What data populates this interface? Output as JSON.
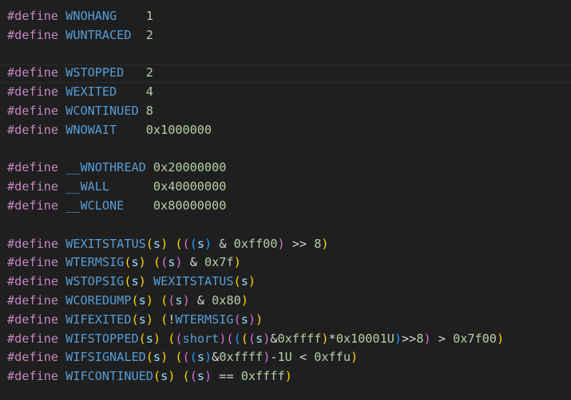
{
  "editor": {
    "language": "c",
    "current_line_index": 3,
    "theme_colors": {
      "background": "#1f1f1f",
      "directive": "#c586c0",
      "macro": "#569cd6",
      "number": "#b5cea8",
      "operator": "#d4d4d4",
      "param": "#9cdcfe",
      "bracket_gold": "#ffd700",
      "bracket_pink": "#da70d6",
      "bracket_blue": "#179fff"
    },
    "lines": [
      {
        "text": "#define WNOHANG    1",
        "tokens": [
          {
            "t": "#define",
            "c": "directive"
          },
          {
            "t": " "
          },
          {
            "t": "WNOHANG",
            "c": "macro"
          },
          {
            "t": "    "
          },
          {
            "t": "1",
            "c": "number"
          }
        ]
      },
      {
        "text": "#define WUNTRACED  2",
        "tokens": [
          {
            "t": "#define",
            "c": "directive"
          },
          {
            "t": " "
          },
          {
            "t": "WUNTRACED",
            "c": "macro"
          },
          {
            "t": "  "
          },
          {
            "t": "2",
            "c": "number"
          }
        ]
      },
      {
        "text": "",
        "tokens": []
      },
      {
        "text": "#define WSTOPPED   2",
        "tokens": [
          {
            "t": "#define",
            "c": "directive"
          },
          {
            "t": " "
          },
          {
            "t": "WSTOPPED",
            "c": "macro"
          },
          {
            "t": "   "
          },
          {
            "t": "2",
            "c": "number"
          }
        ]
      },
      {
        "text": "#define WEXITED    4",
        "tokens": [
          {
            "t": "#define",
            "c": "directive"
          },
          {
            "t": " "
          },
          {
            "t": "WEXITED",
            "c": "macro"
          },
          {
            "t": "    "
          },
          {
            "t": "4",
            "c": "number"
          }
        ]
      },
      {
        "text": "#define WCONTINUED 8",
        "tokens": [
          {
            "t": "#define",
            "c": "directive"
          },
          {
            "t": " "
          },
          {
            "t": "WCONTINUED",
            "c": "macro"
          },
          {
            "t": " "
          },
          {
            "t": "8",
            "c": "number"
          }
        ]
      },
      {
        "text": "#define WNOWAIT    0x1000000",
        "tokens": [
          {
            "t": "#define",
            "c": "directive"
          },
          {
            "t": " "
          },
          {
            "t": "WNOWAIT",
            "c": "macro"
          },
          {
            "t": "    "
          },
          {
            "t": "0x1000000",
            "c": "number"
          }
        ]
      },
      {
        "text": "",
        "tokens": []
      },
      {
        "text": "#define __WNOTHREAD 0x20000000",
        "tokens": [
          {
            "t": "#define",
            "c": "directive"
          },
          {
            "t": " "
          },
          {
            "t": "__WNOTHREAD",
            "c": "macro"
          },
          {
            "t": " "
          },
          {
            "t": "0x20000000",
            "c": "number"
          }
        ]
      },
      {
        "text": "#define __WALL      0x40000000",
        "tokens": [
          {
            "t": "#define",
            "c": "directive"
          },
          {
            "t": " "
          },
          {
            "t": "__WALL",
            "c": "macro"
          },
          {
            "t": "      "
          },
          {
            "t": "0x40000000",
            "c": "number"
          }
        ]
      },
      {
        "text": "#define __WCLONE    0x80000000",
        "tokens": [
          {
            "t": "#define",
            "c": "directive"
          },
          {
            "t": " "
          },
          {
            "t": "__WCLONE",
            "c": "macro"
          },
          {
            "t": "    "
          },
          {
            "t": "0x80000000",
            "c": "number"
          }
        ]
      },
      {
        "text": "",
        "tokens": []
      },
      {
        "text": "#define WEXITSTATUS(s) (((s) & 0xff00) >> 8)",
        "tokens": [
          {
            "t": "#define",
            "c": "directive"
          },
          {
            "t": " "
          },
          {
            "t": "WEXITSTATUS",
            "c": "macro"
          },
          {
            "t": "(",
            "c": "bracket_gold"
          },
          {
            "t": "s",
            "c": "param"
          },
          {
            "t": ")",
            "c": "bracket_gold"
          },
          {
            "t": " "
          },
          {
            "t": "(",
            "c": "bracket_gold"
          },
          {
            "t": "(",
            "c": "bracket_pink"
          },
          {
            "t": "(",
            "c": "bracket_blue"
          },
          {
            "t": "s",
            "c": "param"
          },
          {
            "t": ")",
            "c": "bracket_blue"
          },
          {
            "t": " & ",
            "c": "operator"
          },
          {
            "t": "0xff00",
            "c": "number"
          },
          {
            "t": ")",
            "c": "bracket_pink"
          },
          {
            "t": " >> ",
            "c": "operator"
          },
          {
            "t": "8",
            "c": "number"
          },
          {
            "t": ")",
            "c": "bracket_gold"
          }
        ]
      },
      {
        "text": "#define WTERMSIG(s) ((s) & 0x7f)",
        "tokens": [
          {
            "t": "#define",
            "c": "directive"
          },
          {
            "t": " "
          },
          {
            "t": "WTERMSIG",
            "c": "macro"
          },
          {
            "t": "(",
            "c": "bracket_gold"
          },
          {
            "t": "s",
            "c": "param"
          },
          {
            "t": ")",
            "c": "bracket_gold"
          },
          {
            "t": " "
          },
          {
            "t": "(",
            "c": "bracket_gold"
          },
          {
            "t": "(",
            "c": "bracket_pink"
          },
          {
            "t": "s",
            "c": "param"
          },
          {
            "t": ")",
            "c": "bracket_pink"
          },
          {
            "t": " & ",
            "c": "operator"
          },
          {
            "t": "0x7f",
            "c": "number"
          },
          {
            "t": ")",
            "c": "bracket_gold"
          }
        ]
      },
      {
        "text": "#define WSTOPSIG(s) WEXITSTATUS(s)",
        "tokens": [
          {
            "t": "#define",
            "c": "directive"
          },
          {
            "t": " "
          },
          {
            "t": "WSTOPSIG",
            "c": "macro"
          },
          {
            "t": "(",
            "c": "bracket_gold"
          },
          {
            "t": "s",
            "c": "param"
          },
          {
            "t": ")",
            "c": "bracket_gold"
          },
          {
            "t": " "
          },
          {
            "t": "WEXITSTATUS",
            "c": "macro"
          },
          {
            "t": "(",
            "c": "bracket_gold"
          },
          {
            "t": "s",
            "c": "param"
          },
          {
            "t": ")",
            "c": "bracket_gold"
          }
        ]
      },
      {
        "text": "#define WCOREDUMP(s) ((s) & 0x80)",
        "tokens": [
          {
            "t": "#define",
            "c": "directive"
          },
          {
            "t": " "
          },
          {
            "t": "WCOREDUMP",
            "c": "macro"
          },
          {
            "t": "(",
            "c": "bracket_gold"
          },
          {
            "t": "s",
            "c": "param"
          },
          {
            "t": ")",
            "c": "bracket_gold"
          },
          {
            "t": " "
          },
          {
            "t": "(",
            "c": "bracket_gold"
          },
          {
            "t": "(",
            "c": "bracket_pink"
          },
          {
            "t": "s",
            "c": "param"
          },
          {
            "t": ")",
            "c": "bracket_pink"
          },
          {
            "t": " & ",
            "c": "operator"
          },
          {
            "t": "0x80",
            "c": "number"
          },
          {
            "t": ")",
            "c": "bracket_gold"
          }
        ]
      },
      {
        "text": "#define WIFEXITED(s) (!WTERMSIG(s))",
        "tokens": [
          {
            "t": "#define",
            "c": "directive"
          },
          {
            "t": " "
          },
          {
            "t": "WIFEXITED",
            "c": "macro"
          },
          {
            "t": "(",
            "c": "bracket_gold"
          },
          {
            "t": "s",
            "c": "param"
          },
          {
            "t": ")",
            "c": "bracket_gold"
          },
          {
            "t": " "
          },
          {
            "t": "(",
            "c": "bracket_gold"
          },
          {
            "t": "!",
            "c": "operator"
          },
          {
            "t": "WTERMSIG",
            "c": "macro"
          },
          {
            "t": "(",
            "c": "bracket_pink"
          },
          {
            "t": "s",
            "c": "param"
          },
          {
            "t": ")",
            "c": "bracket_pink"
          },
          {
            "t": ")",
            "c": "bracket_gold"
          }
        ]
      },
      {
        "text": "#define WIFSTOPPED(s) ((short)((((s)&0xffff)*0x10001U)>>8) > 0x7f00)",
        "tokens": [
          {
            "t": "#define",
            "c": "directive"
          },
          {
            "t": " "
          },
          {
            "t": "WIFSTOPPED",
            "c": "macro"
          },
          {
            "t": "(",
            "c": "bracket_gold"
          },
          {
            "t": "s",
            "c": "param"
          },
          {
            "t": ")",
            "c": "bracket_gold"
          },
          {
            "t": " "
          },
          {
            "t": "(",
            "c": "bracket_gold"
          },
          {
            "t": "(",
            "c": "bracket_pink"
          },
          {
            "t": "short",
            "c": "macro"
          },
          {
            "t": ")",
            "c": "bracket_pink"
          },
          {
            "t": "(",
            "c": "bracket_pink"
          },
          {
            "t": "(",
            "c": "bracket_blue"
          },
          {
            "t": "(",
            "c": "bracket_gold"
          },
          {
            "t": "(",
            "c": "bracket_pink"
          },
          {
            "t": "s",
            "c": "param"
          },
          {
            "t": ")",
            "c": "bracket_pink"
          },
          {
            "t": "&",
            "c": "operator"
          },
          {
            "t": "0xffff",
            "c": "number"
          },
          {
            "t": ")",
            "c": "bracket_gold"
          },
          {
            "t": "*",
            "c": "operator"
          },
          {
            "t": "0x10001U",
            "c": "number"
          },
          {
            "t": ")",
            "c": "bracket_blue"
          },
          {
            "t": ">>",
            "c": "operator"
          },
          {
            "t": "8",
            "c": "number"
          },
          {
            "t": ")",
            "c": "bracket_pink"
          },
          {
            "t": " > ",
            "c": "operator"
          },
          {
            "t": "0x7f00",
            "c": "number"
          },
          {
            "t": ")",
            "c": "bracket_gold"
          }
        ]
      },
      {
        "text": "#define WIFSIGNALED(s) (((s)&0xffff)-1U < 0xffu)",
        "tokens": [
          {
            "t": "#define",
            "c": "directive"
          },
          {
            "t": " "
          },
          {
            "t": "WIFSIGNALED",
            "c": "macro"
          },
          {
            "t": "(",
            "c": "bracket_gold"
          },
          {
            "t": "s",
            "c": "param"
          },
          {
            "t": ")",
            "c": "bracket_gold"
          },
          {
            "t": " "
          },
          {
            "t": "(",
            "c": "bracket_gold"
          },
          {
            "t": "(",
            "c": "bracket_pink"
          },
          {
            "t": "(",
            "c": "bracket_blue"
          },
          {
            "t": "s",
            "c": "param"
          },
          {
            "t": ")",
            "c": "bracket_blue"
          },
          {
            "t": "&",
            "c": "operator"
          },
          {
            "t": "0xffff",
            "c": "number"
          },
          {
            "t": ")",
            "c": "bracket_pink"
          },
          {
            "t": "-",
            "c": "operator"
          },
          {
            "t": "1U",
            "c": "number"
          },
          {
            "t": " < ",
            "c": "operator"
          },
          {
            "t": "0xffu",
            "c": "number"
          },
          {
            "t": ")",
            "c": "bracket_gold"
          }
        ]
      },
      {
        "text": "#define WIFCONTINUED(s) ((s) == 0xffff)",
        "tokens": [
          {
            "t": "#define",
            "c": "directive"
          },
          {
            "t": " "
          },
          {
            "t": "WIFCONTINUED",
            "c": "macro"
          },
          {
            "t": "(",
            "c": "bracket_gold"
          },
          {
            "t": "s",
            "c": "param"
          },
          {
            "t": ")",
            "c": "bracket_gold"
          },
          {
            "t": " "
          },
          {
            "t": "(",
            "c": "bracket_gold"
          },
          {
            "t": "(",
            "c": "bracket_pink"
          },
          {
            "t": "s",
            "c": "param"
          },
          {
            "t": ")",
            "c": "bracket_pink"
          },
          {
            "t": " == ",
            "c": "operator"
          },
          {
            "t": "0xffff",
            "c": "number"
          },
          {
            "t": ")",
            "c": "bracket_gold"
          }
        ]
      }
    ]
  }
}
